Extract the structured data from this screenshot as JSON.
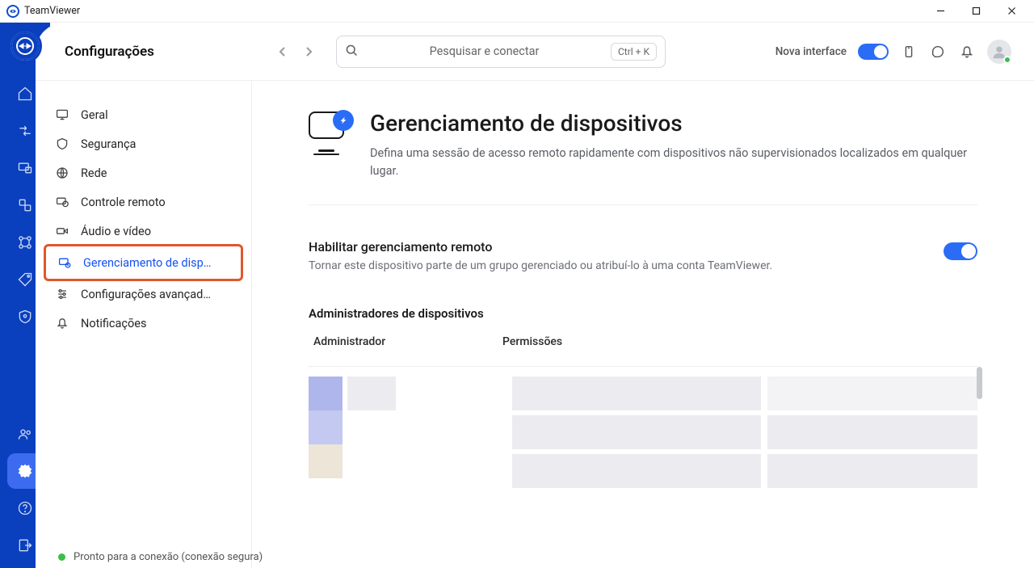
{
  "window": {
    "title": "TeamViewer"
  },
  "header": {
    "title": "Configurações",
    "search_placeholder": "Pesquisar e conectar",
    "shortcut": "Ctrl + K",
    "new_interface_label": "Nova interface"
  },
  "settings_nav": {
    "items": [
      {
        "label": "Geral",
        "icon": "monitor"
      },
      {
        "label": "Segurança",
        "icon": "shield"
      },
      {
        "label": "Rede",
        "icon": "globe"
      },
      {
        "label": "Controle remoto",
        "icon": "remote"
      },
      {
        "label": "Áudio e vídeo",
        "icon": "camera"
      },
      {
        "label": "Gerenciamento de disp…",
        "icon": "device-mgmt",
        "active": true,
        "highlighted": true
      },
      {
        "label": "Configurações avançad…",
        "icon": "sliders"
      },
      {
        "label": "Notificações",
        "icon": "bell"
      }
    ]
  },
  "page": {
    "title": "Gerenciamento de dispositivos",
    "subtitle": "Defina uma sessão de acesso remoto rapidamente com dispositivos não supervisionados localizados em qualquer lugar.",
    "enable_heading": "Habilitar gerenciamento remoto",
    "enable_desc": "Tornar este dispositivo parte de um grupo gerenciado ou atribuí-lo à uma conta TeamViewer.",
    "admins_heading": "Administradores de dispositivos",
    "col_admin": "Administrador",
    "col_perm": "Permissões"
  },
  "status": {
    "text": "Pronto para a conexão (conexão segura)"
  }
}
